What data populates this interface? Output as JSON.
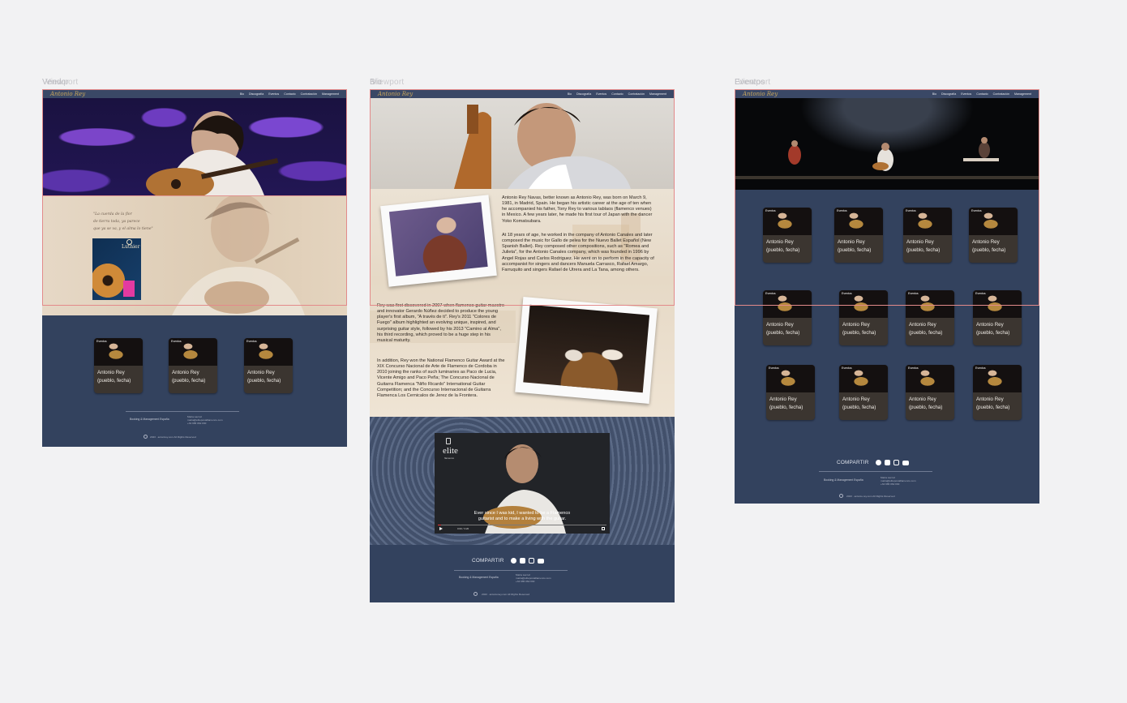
{
  "frames": [
    {
      "label": "Vendor / Viewport overlapped",
      "label_a": "Vendor",
      "label_b": "Viewport"
    },
    {
      "label_a": "Bio",
      "label_b": "Viewport"
    },
    {
      "label_a": "Eventos",
      "label_b": "Viewport"
    }
  ],
  "nav": {
    "logo": "Antonio Rey",
    "links": [
      "Bio",
      "Discografía",
      "Eventos",
      "Contacto",
      "Contratación",
      "Management"
    ]
  },
  "quote": {
    "lines": [
      "\"La cuerda de la flor",
      "de tierra toda, ya parece",
      "que ya se va, y el alma lo tiene\""
    ]
  },
  "album": {
    "title": "Luthier"
  },
  "cards": {
    "tag": "Eventos",
    "caption": "Antonio Rey (pueblo, fecha)"
  },
  "footer": {
    "booking": "Booking & Management España",
    "contact_name": "Marta Lacruz",
    "contact_email": "marta@elitepostaflamenco.com",
    "contact_phone": "+34 665 062 030",
    "copyright_1": "2023 · antonirey.com All Rights Reserved",
    "copyright_2": "2023 · antonioney.com All Rights Reserved",
    "copyright_3": "2023 · antonio-rey.com All Rights Reserved",
    "share": "COMPARTIR"
  },
  "bio": {
    "p1": "Antonio Rey Navas, better known as Antonio Rey, was born on March 9, 1981, in Madrid, Spain. He began his artistic career at the age of ten when he accompanied his father, Tony Rey to various tablaos (flamenco venues) in Mexico. A few years later, he made his first tour of Japan with the dancer Yoko Komatsubara.",
    "p2": "At 18 years of age, he worked in the company of Antonio Canales and later composed the music for Gallo de pelea for the Nuevo Ballet Español (New Spanish Ballet). Rey composed other compositions, such as \"Romea and Julieta\", for the Antonio Canales company, which was founded in 1996 by Angel Rojas and Carlos Rodriguez. He went on to perform in the capacity of accompanist for singers and dancers Manuela Carrasco, Rafael Amargo, Farruquito and singers Rafael de Utrera and La Tana, among others.",
    "p3": "Rey was first discovered in 2007 when flamenco guitar maestro and innovator Gerardo Núñez decided to produce the young player's first album, \"A través de ti\". Rey's 2011 \"Colores de Fuego\" album highlighted an evolving unique, inspired, and surprising guitar style, followed by his 2013 \"Camino al Alma\", his third recording, which proved to be a huge step in his musical maturity.",
    "p4": "In addition, Rey won the National Flamenco Guitar Award at the XIX Concurso Nacional de Arte de Flamenco de Cordoba in 2010 joining the ranks of such luminaries as Paco de Lucia, Vicente Amigo and Paco Peña; The Concurso Nacional de Guitarra Flamenca \"Niño Ricardo\" International Guitar Competition; and the Concurso Internacional de Guitarra Flamenca Los Cernicalos de Jerez de la Frontera."
  },
  "video": {
    "brand": "elite",
    "brand_sub": "flamenco",
    "subtitle_1": "Ever since I was kid, I wanted to be a Flamenco",
    "subtitle_2": "guitarist and to make a living with the guitar.",
    "time": "0:00 / 3:20"
  },
  "colors": {
    "navy": "#33425e",
    "nav": "#3a4866",
    "gold": "#c9a65c",
    "card": "#3b3530"
  }
}
